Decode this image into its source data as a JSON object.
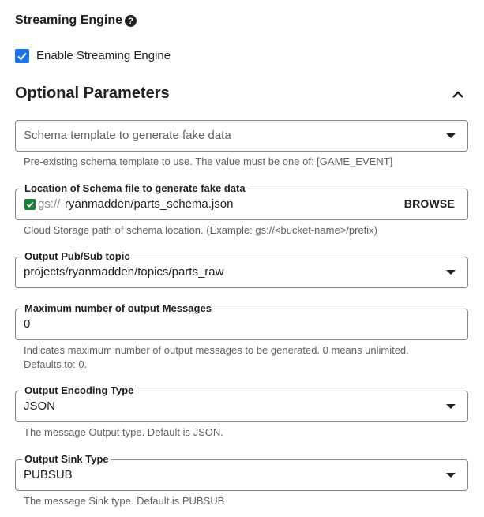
{
  "streaming_engine": {
    "title": "Streaming Engine",
    "help_icon": "help-circle-icon",
    "checkbox_label": "Enable Streaming Engine",
    "checked": true
  },
  "optional_parameters": {
    "title": "Optional Parameters",
    "collapse_icon": "chevron-up-icon"
  },
  "fields": {
    "schema_template": {
      "placeholder": "Schema template to generate fake data",
      "hint": "Pre-existing schema template to use. The value must be one of: [GAME_EVENT]"
    },
    "schema_location": {
      "label": "Location of Schema file to generate fake data",
      "prefix": "gs://",
      "value": "ryanmadden/parts_schema.json",
      "browse_label": "BROWSE",
      "hint": "Cloud Storage path of schema location. (Example: gs://<bucket-name>/prefix)"
    },
    "output_topic": {
      "label": "Output Pub/Sub topic",
      "value": "projects/ryanmadden/topics/parts_raw"
    },
    "max_messages": {
      "label": "Maximum number of output Messages",
      "value": "0",
      "hint_line1": "Indicates maximum number of output messages to be generated. 0 means unlimited.",
      "hint_line2": "Defaults to: 0."
    },
    "encoding_type": {
      "label": "Output Encoding Type",
      "value": "JSON",
      "hint": "The message Output type. Default is JSON."
    },
    "sink_type": {
      "label": "Output Sink Type",
      "value": "PUBSUB",
      "hint": "The message Sink type. Default is PUBSUB"
    }
  },
  "colors": {
    "accent": "#1a73e8",
    "valid": "#188038",
    "border": "#80868b",
    "hint_text": "#5f6368"
  }
}
